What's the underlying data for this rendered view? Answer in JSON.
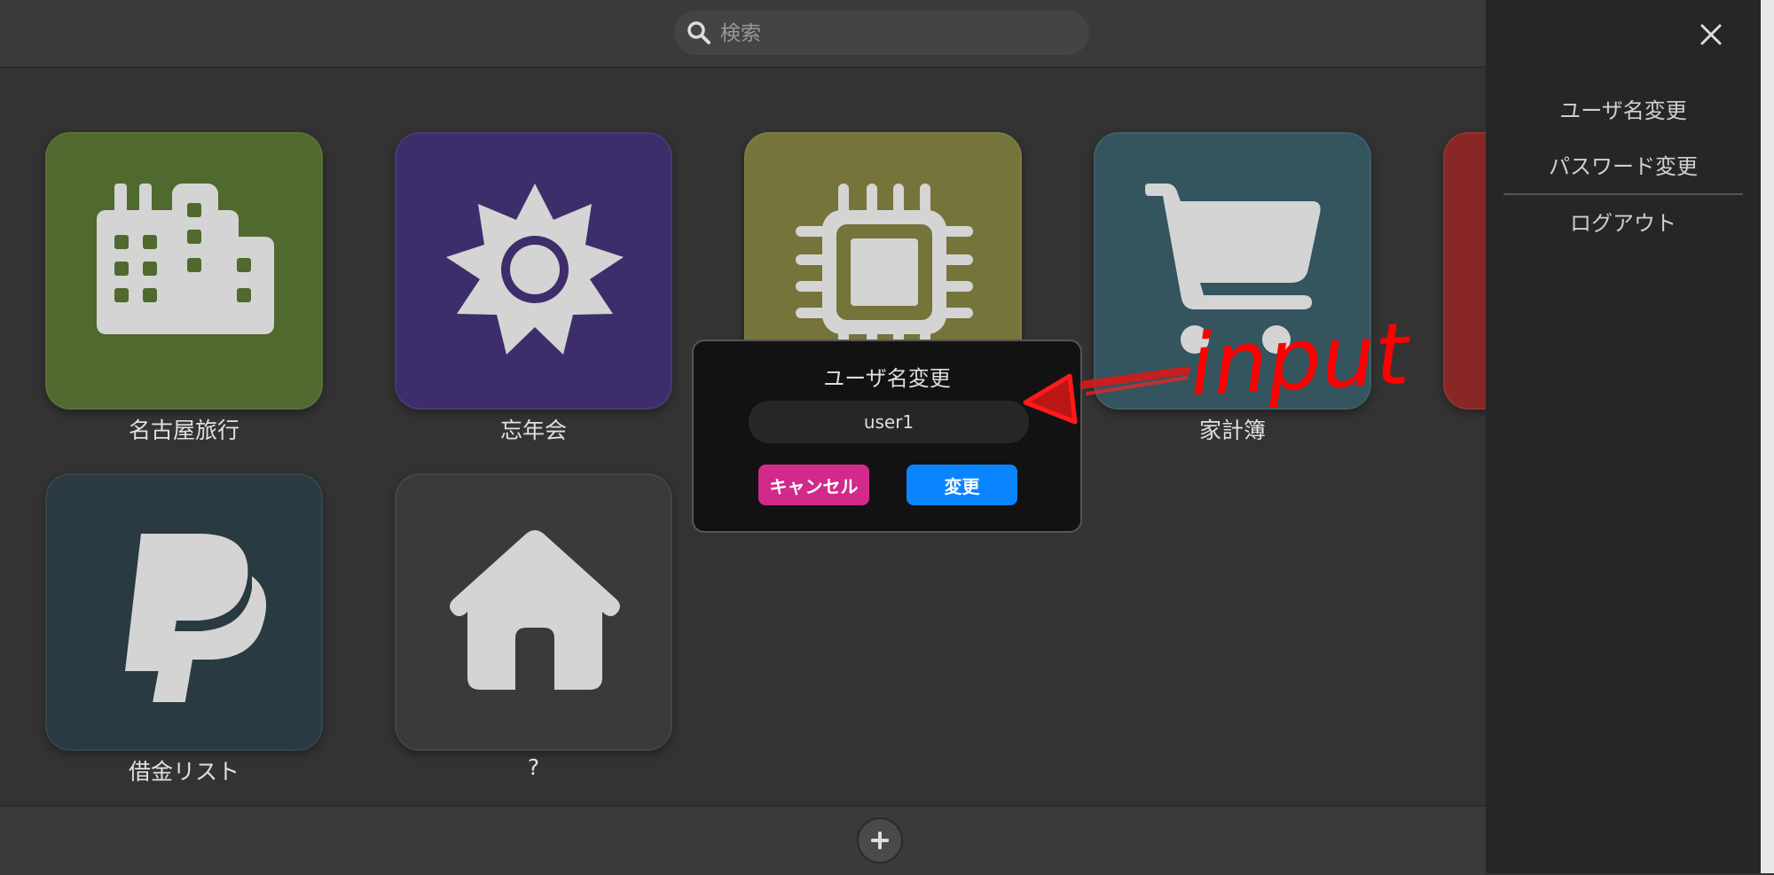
{
  "search": {
    "placeholder": "検索",
    "icon": "search-icon"
  },
  "tiles": [
    {
      "label": "名古屋旅行",
      "color": "#50692f",
      "icon": "city-icon"
    },
    {
      "label": "忘年会",
      "color": "#3e2d6b",
      "icon": "sun-icon"
    },
    {
      "label": "",
      "color": "#75743a",
      "icon": "microchip-icon"
    },
    {
      "label": "家計簿",
      "color": "#34545e",
      "icon": "shopping-cart-icon"
    },
    {
      "label": "",
      "color": "#892626",
      "icon": ""
    },
    {
      "label": "借金リスト",
      "color": "#2a3a42",
      "icon": "paypal-icon"
    },
    {
      "label": "?",
      "color": "#3a3a3a",
      "icon": "home-icon"
    }
  ],
  "bottombar": {
    "add_icon": "plus-icon"
  },
  "sidepanel": {
    "close_icon": "close-icon",
    "items": [
      {
        "label": "ユーザ名変更"
      },
      {
        "label": "パスワード変更"
      },
      {
        "label": "ログアウト"
      }
    ]
  },
  "dialog": {
    "title": "ユーザ名変更",
    "input_value": "user1",
    "cancel_label": "キャンセル",
    "confirm_label": "変更"
  },
  "annotation": {
    "text": "input",
    "color": "#ff0000"
  }
}
